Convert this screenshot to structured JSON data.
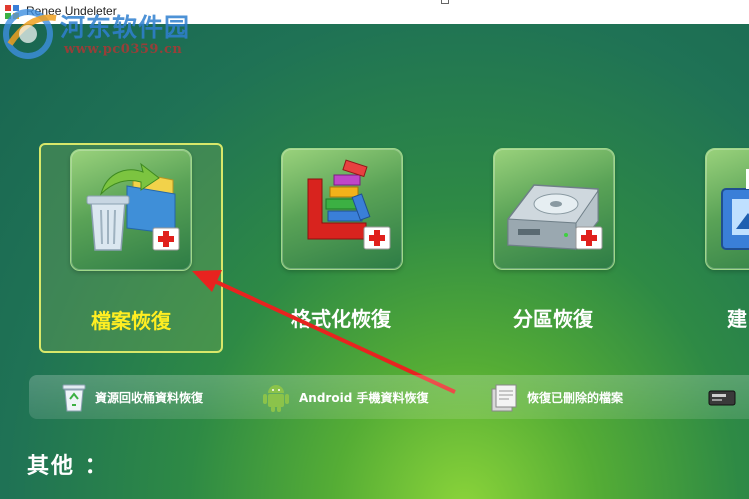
{
  "window": {
    "title": "Renee Undeleter"
  },
  "watermark": {
    "text": "河东软件园",
    "url": "www.pc0359.cn"
  },
  "modes": [
    {
      "label": "檔案恢復",
      "icon": "file-recovery-icon",
      "selected": true
    },
    {
      "label": "格式化恢復",
      "icon": "format-recovery-icon",
      "selected": false
    },
    {
      "label": "分區恢復",
      "icon": "partition-recovery-icon",
      "selected": false
    },
    {
      "label": "建",
      "icon": "image-backup-icon",
      "selected": false
    }
  ],
  "quick_actions": [
    {
      "label": "資源回收桶資料恢復",
      "icon": "recycle-bin-icon"
    },
    {
      "label": "Android 手機資料恢復",
      "icon": "android-icon"
    },
    {
      "label": "恢復已刪除的檔案",
      "icon": "deleted-file-icon"
    },
    {
      "label": "",
      "icon": "card-reader-icon"
    }
  ],
  "other": {
    "label": "其他 ："
  },
  "colors": {
    "selected_label": "#ffee22",
    "selected_border": "#d8e86a",
    "arrow": "#e8231f",
    "watermark_text": "#2f7fd0",
    "watermark_url": "#c03030"
  }
}
